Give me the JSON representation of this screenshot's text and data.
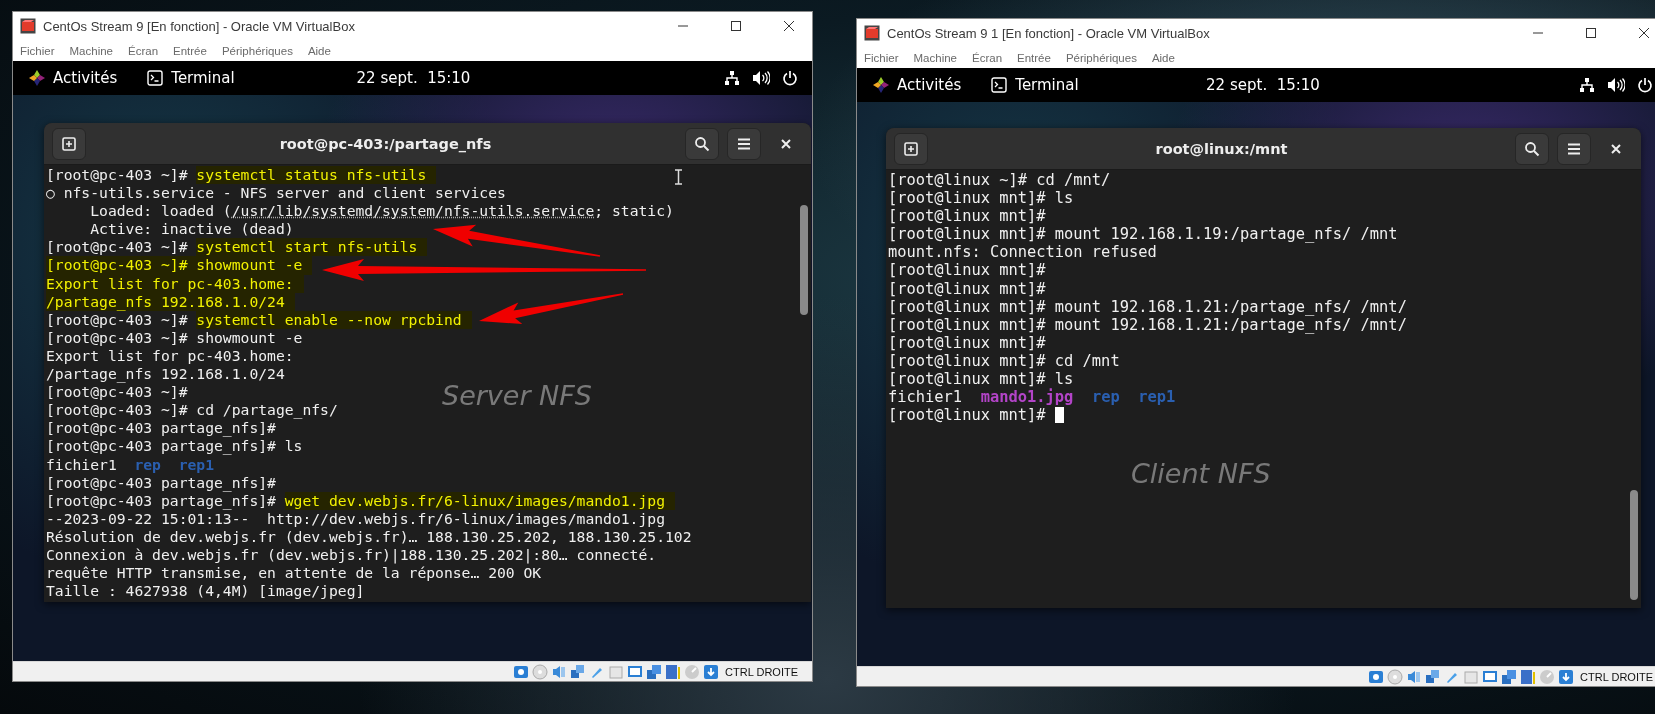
{
  "vm_windows": [
    {
      "title": "CentOs Stream 9 [En fonction] - Oracle VM VirtualBox",
      "menu": [
        "Fichier",
        "Machine",
        "Écran",
        "Entrée",
        "Périphériques",
        "Aide"
      ],
      "top_bar": {
        "activities": "Activités",
        "app": "Terminal",
        "clock": "22 sept.  15:10"
      },
      "terminal": {
        "title": "root@pc-403:/partage_nfs",
        "cursor": false,
        "annotation": "Server NFS",
        "lines": [
          [
            {
              "kind": "text",
              "text": "[root@pc-403 ~]# "
            },
            {
              "kind": "cmd",
              "text": "systemctl status nfs-utils"
            }
          ],
          [
            {
              "kind": "text",
              "text": "○ nfs-utils.service - NFS server and client services"
            }
          ],
          [
            {
              "kind": "text",
              "text": "     Loaded: loaded ("
            },
            {
              "kind": "link",
              "text": "/usr/lib/systemd/system/nfs-utils.service"
            },
            {
              "kind": "text",
              "text": "; static)"
            }
          ],
          [
            {
              "kind": "text",
              "text": "     Active: inactive (dead)"
            }
          ],
          [
            {
              "kind": "text",
              "text": "[root@pc-403 ~]# "
            },
            {
              "kind": "cmd",
              "text": "systemctl start nfs-utils"
            }
          ],
          [
            {
              "kind": "cmd",
              "text": "[root@pc-403 ~]# showmount -e"
            }
          ],
          [
            {
              "kind": "cmd",
              "text": "Export list for pc-403.home:"
            }
          ],
          [
            {
              "kind": "cmd",
              "text": "/partage_nfs 192.168.1.0/24"
            }
          ],
          [
            {
              "kind": "text",
              "text": "[root@pc-403 ~]# "
            },
            {
              "kind": "cmd",
              "text": "systemctl enable --now rpcbind"
            }
          ],
          [
            {
              "kind": "text",
              "text": "[root@pc-403 ~]# showmount -e"
            }
          ],
          [
            {
              "kind": "text",
              "text": "Export list for pc-403.home:"
            }
          ],
          [
            {
              "kind": "text",
              "text": "/partage_nfs 192.168.1.0/24"
            }
          ],
          [
            {
              "kind": "text",
              "text": "[root@pc-403 ~]#"
            }
          ],
          [
            {
              "kind": "text",
              "text": "[root@pc-403 ~]# cd /partage_nfs/"
            }
          ],
          [
            {
              "kind": "text",
              "text": "[root@pc-403 partage_nfs]#"
            }
          ],
          [
            {
              "kind": "text",
              "text": "[root@pc-403 partage_nfs]# ls"
            }
          ],
          [
            {
              "kind": "text",
              "text": "fichier1"
            },
            {
              "kind": "dir",
              "text": "rep"
            },
            {
              "kind": "dir",
              "text": "rep1"
            }
          ],
          [
            {
              "kind": "text",
              "text": "[root@pc-403 partage_nfs]#"
            }
          ],
          [
            {
              "kind": "text",
              "text": "[root@pc-403 partage_nfs]# "
            },
            {
              "kind": "cmd",
              "text": "wget dev.webjs.fr/6-linux/images/mando1.jpg"
            }
          ],
          [
            {
              "kind": "text",
              "text": "--2023-09-22 15:01:13--  http://dev.webjs.fr/6-linux/images/mando1.jpg"
            }
          ],
          [
            {
              "kind": "text",
              "text": "Résolution de dev.webjs.fr (dev.webjs.fr)… 188.130.25.202, 188.130.25.102"
            }
          ],
          [
            {
              "kind": "text",
              "text": "Connexion à dev.webjs.fr (dev.webjs.fr)|188.130.25.202|:80… connecté."
            }
          ],
          [
            {
              "kind": "text",
              "text": "requête HTTP transmise, en attente de la réponse… 200 OK"
            }
          ],
          [
            {
              "kind": "text",
              "text": "Taille : 4627938 (4,4M) [image/jpeg]"
            }
          ]
        ]
      },
      "host_key": "CTRL DROITE"
    },
    {
      "title": "CentOs Stream 9 1 [En fonction] - Oracle VM VirtualBox",
      "menu": [
        "Fichier",
        "Machine",
        "Écran",
        "Entrée",
        "Périphériques",
        "Aide"
      ],
      "top_bar": {
        "activities": "Activités",
        "app": "Terminal",
        "clock": "22 sept.  15:10"
      },
      "terminal": {
        "title": "root@linux:/mnt",
        "cursor": true,
        "annotation": "Client NFS",
        "lines": [
          [
            {
              "kind": "text",
              "text": "[root@linux ~]# cd /mnt/"
            }
          ],
          [
            {
              "kind": "text",
              "text": "[root@linux mnt]# ls"
            }
          ],
          [
            {
              "kind": "text",
              "text": "[root@linux mnt]#"
            }
          ],
          [
            {
              "kind": "text",
              "text": "[root@linux mnt]# mount 192.168.1.19:/partage_nfs/ /mnt"
            }
          ],
          [
            {
              "kind": "text",
              "text": "mount.nfs: Connection refused"
            }
          ],
          [
            {
              "kind": "text",
              "text": "[root@linux mnt]#"
            }
          ],
          [
            {
              "kind": "text",
              "text": "[root@linux mnt]#"
            }
          ],
          [
            {
              "kind": "text",
              "text": "[root@linux mnt]# mount 192.168.1.21:/partage_nfs/ /mnt/"
            }
          ],
          [
            {
              "kind": "text",
              "text": "[root@linux mnt]# mount 192.168.1.21:/partage_nfs/ /mnt/"
            }
          ],
          [
            {
              "kind": "text",
              "text": "[root@linux mnt]#"
            }
          ],
          [
            {
              "kind": "text",
              "text": "[root@linux mnt]# cd /mnt"
            }
          ],
          [
            {
              "kind": "text",
              "text": "[root@linux mnt]# ls"
            }
          ],
          [
            {
              "kind": "text",
              "text": "fichier1"
            },
            {
              "kind": "image",
              "text": "mando1.jpg"
            },
            {
              "kind": "dir",
              "text": "rep"
            },
            {
              "kind": "dir",
              "text": "rep1"
            }
          ],
          [
            {
              "kind": "text",
              "text": "[root@linux mnt]# "
            }
          ]
        ]
      },
      "host_key": "CTRL DROITE"
    }
  ]
}
